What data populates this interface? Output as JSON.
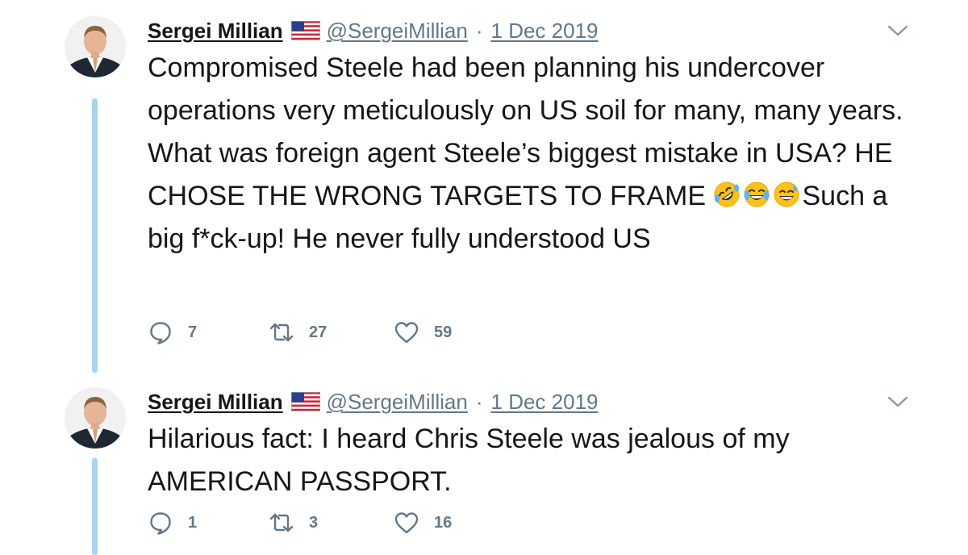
{
  "tweets": [
    {
      "author_name": "Sergei Millian",
      "author_flag": "us-flag-icon",
      "handle": "@SergeiMillian",
      "separator": "·",
      "date": "1 Dec 2019",
      "text_part1": "Compromised Steele had been planning his undercover operations very meticulously on US soil for many, many years. What was foreign agent Steele’s biggest mistake in USA? HE CHOSE THE WRONG TARGETS TO FRAME ",
      "emojis": [
        "rolling-on-floor-laughing-emoji",
        "tears-of-joy-emoji",
        "grinning-sweat-emoji"
      ],
      "text_part2": "Such a big f*ck-up! He never fully understood US",
      "replies": "7",
      "retweets": "27",
      "likes": "59"
    },
    {
      "author_name": "Sergei Millian",
      "author_flag": "us-flag-icon",
      "handle": "@SergeiMillian",
      "separator": "·",
      "date": "1 Dec 2019",
      "text_part1": "Hilarious fact: I heard Chris Steele was jealous of my AMERICAN PASSPORT.",
      "text_part2": "",
      "replies": "1",
      "retweets": "3",
      "likes": "16"
    }
  ],
  "colors": {
    "text": "#14171a",
    "secondary": "#657786",
    "thread_line": "#a8d4f4",
    "background": "#ffffff"
  }
}
